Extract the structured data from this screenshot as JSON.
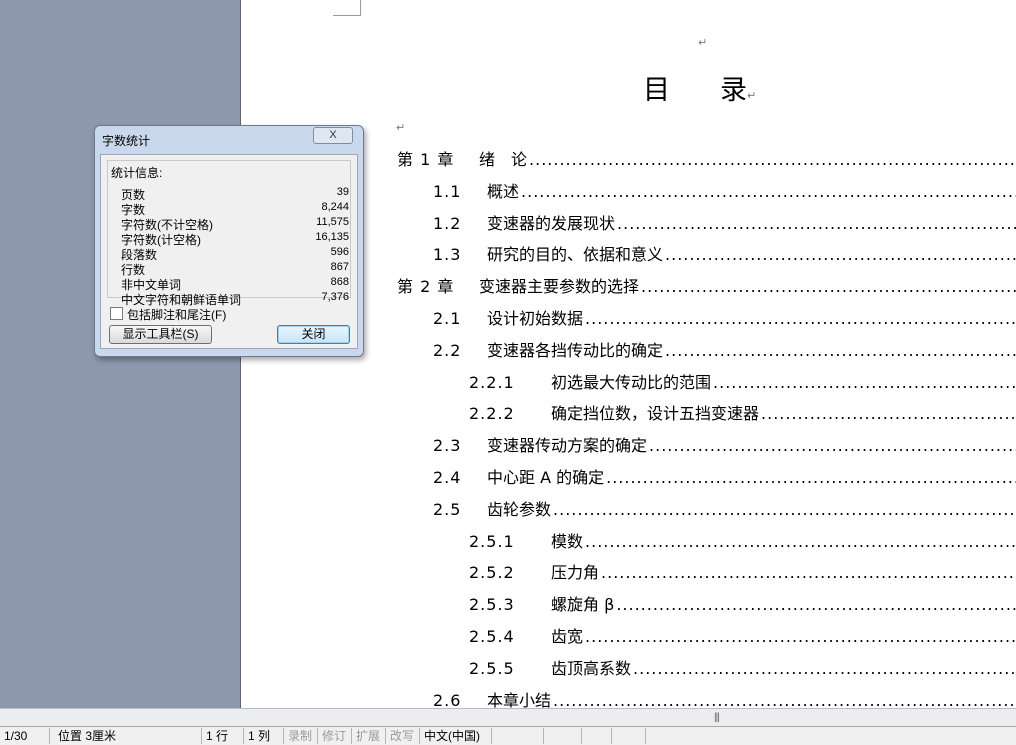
{
  "document": {
    "title_left": "目",
    "title_right": "录",
    "toc": [
      {
        "level": 0,
        "num": "第 1 章",
        "title": "绪　论"
      },
      {
        "level": 1,
        "num": "1.1",
        "title": "概述"
      },
      {
        "level": 1,
        "num": "1.2",
        "title": "变速器的发展现状"
      },
      {
        "level": 1,
        "num": "1.3",
        "title": "研究的目的、依据和意义"
      },
      {
        "level": 0,
        "num": "第 2 章",
        "title": "变速器主要参数的选择"
      },
      {
        "level": 1,
        "num": "2.1",
        "title": "设计初始数据"
      },
      {
        "level": 1,
        "num": "2.2",
        "title": "变速器各挡传动比的确定"
      },
      {
        "level": 2,
        "num": "2.2.1",
        "title": "初选最大传动比的范围"
      },
      {
        "level": 2,
        "num": "2.2.2",
        "title": "确定挡位数，设计五挡变速器"
      },
      {
        "level": 1,
        "num": "2.3",
        "title": "变速器传动方案的确定"
      },
      {
        "level": 1,
        "num": "2.4",
        "title": "中心距 A 的确定"
      },
      {
        "level": 1,
        "num": "2.5",
        "title": "齿轮参数"
      },
      {
        "level": 2,
        "num": "2.5.1",
        "title": "模数"
      },
      {
        "level": 2,
        "num": "2.5.2",
        "title": "压力角"
      },
      {
        "level": 2,
        "num": "2.5.3",
        "title": "螺旋角 β"
      },
      {
        "level": 2,
        "num": "2.5.4",
        "title": "齿宽"
      },
      {
        "level": 2,
        "num": "2.5.5",
        "title": "齿顶高系数"
      },
      {
        "level": 1,
        "num": "2.6",
        "title": "本章小结"
      }
    ]
  },
  "dialog": {
    "title": "字数统计",
    "group_label": "统计信息:",
    "stats": [
      {
        "name": "页数",
        "value": "39"
      },
      {
        "name": "字数",
        "value": "8,244"
      },
      {
        "name": "字符数(不计空格)",
        "value": "11,575"
      },
      {
        "name": "字符数(计空格)",
        "value": "16,135"
      },
      {
        "name": "段落数",
        "value": "596"
      },
      {
        "name": "行数",
        "value": "867"
      },
      {
        "name": "非中文单词",
        "value": "868"
      },
      {
        "name": "中文字符和朝鲜语单词",
        "value": "7,376"
      }
    ],
    "checkbox_label": "包括脚注和尾注(F)",
    "checkbox_checked": false,
    "toolbar_button": "显示工具栏(S)",
    "close_button": "关闭",
    "close_x": "X"
  },
  "statusbar": {
    "page": "1/30",
    "position": "位置 3厘米",
    "row": "1 行",
    "col": "1 列",
    "record": "录制",
    "revise": "修订",
    "extend": "扩展",
    "overtype": "改写",
    "language": "中文(中国)"
  }
}
